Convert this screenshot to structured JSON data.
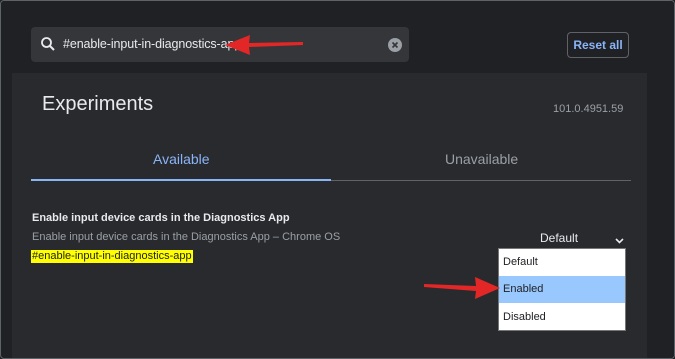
{
  "search": {
    "value": "#enable-input-in-diagnostics-app"
  },
  "toolbar": {
    "reset_label": "Reset all"
  },
  "page": {
    "title": "Experiments",
    "version": "101.0.4951.59"
  },
  "tabs": [
    {
      "label": "Available",
      "selected": true
    },
    {
      "label": "Unavailable",
      "selected": false
    }
  ],
  "feature": {
    "title": "Enable input device cards in the Diagnostics App",
    "description": "Enable input device cards in the Diagnostics App – Chrome OS",
    "tag": "#enable-input-in-diagnostics-app",
    "selected_value": "Default",
    "options": [
      "Default",
      "Enabled",
      "Disabled"
    ],
    "highlighted_option": "Enabled"
  },
  "colors": {
    "accent": "#8ab4f8",
    "highlight": "#ffff00",
    "arrow": "#e32727",
    "option_hover": "#99c8ff"
  },
  "icons": [
    "search-icon",
    "clear-icon",
    "chevron-down-icon",
    "arrow-annotation"
  ]
}
